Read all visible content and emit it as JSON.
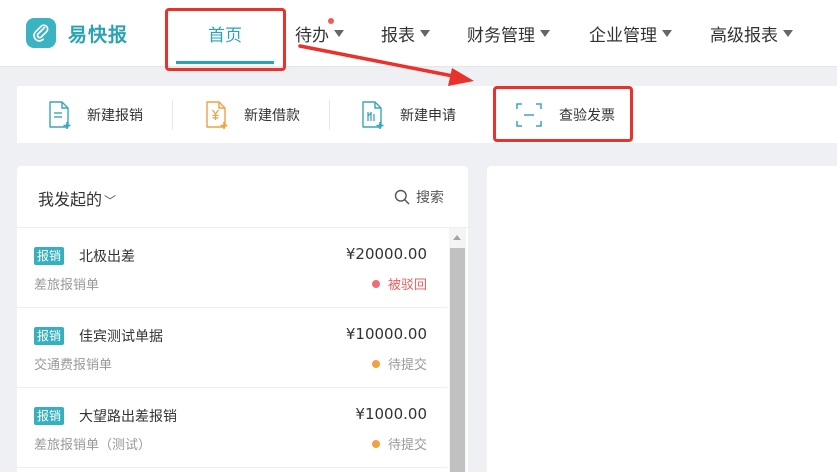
{
  "app": {
    "name": "易快报",
    "brand_color": "#2aa3b3"
  },
  "nav": {
    "items": [
      {
        "label": "首页",
        "active": true
      },
      {
        "label": "待办",
        "has_badge": true
      },
      {
        "label": "报表"
      },
      {
        "label": "财务管理"
      },
      {
        "label": "企业管理"
      },
      {
        "label": "高级报表"
      }
    ]
  },
  "actions": [
    {
      "label": "新建报销",
      "icon": "new-expense-icon"
    },
    {
      "label": "新建借款",
      "icon": "new-loan-icon"
    },
    {
      "label": "新建申请",
      "icon": "new-request-icon"
    },
    {
      "label": "查验发票",
      "icon": "scan-invoice-icon"
    }
  ],
  "panel": {
    "title": "我发起的",
    "search_label": "搜索"
  },
  "list": [
    {
      "tag": "报销",
      "title": "北极出差",
      "subtitle": "差旅报销单",
      "amount": "¥20000.00",
      "status": "被驳回",
      "status_color": "#e86060",
      "status_dot": "#ee6e73"
    },
    {
      "tag": "报销",
      "title": "佳宾测试单据",
      "subtitle": "交通费报销单",
      "amount": "¥10000.00",
      "status": "待提交",
      "status_color": "#999999",
      "status_dot": "#f0a145"
    },
    {
      "tag": "报销",
      "title": "大望路出差报销",
      "subtitle": "差旅报销单（测试）",
      "amount": "¥1000.00",
      "status": "待提交",
      "status_color": "#999999",
      "status_dot": "#f0a145"
    }
  ],
  "annotation_color": "#e8322b"
}
